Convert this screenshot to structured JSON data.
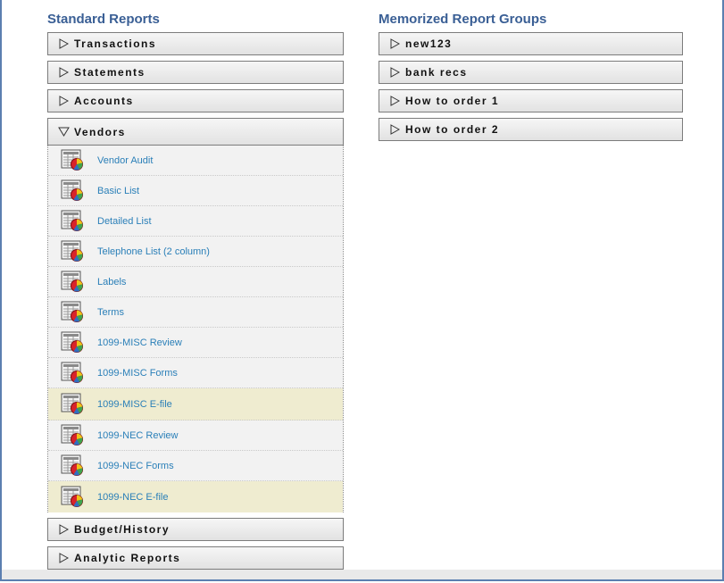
{
  "standard": {
    "title": "Standard Reports",
    "groups_top": [
      {
        "label": "Transactions"
      },
      {
        "label": "Statements"
      },
      {
        "label": "Accounts"
      }
    ],
    "open_group": {
      "label": "Vendors",
      "reports": [
        {
          "label": "Vendor Audit",
          "selected": false
        },
        {
          "label": "Basic List",
          "selected": false
        },
        {
          "label": "Detailed List",
          "selected": false
        },
        {
          "label": "Telephone List (2 column)",
          "selected": false
        },
        {
          "label": "Labels",
          "selected": false
        },
        {
          "label": "Terms",
          "selected": false
        },
        {
          "label": "1099-MISC Review",
          "selected": false
        },
        {
          "label": "1099-MISC Forms",
          "selected": false
        },
        {
          "label": "1099-MISC E-file",
          "selected": true
        },
        {
          "label": "1099-NEC Review",
          "selected": false
        },
        {
          "label": "1099-NEC Forms",
          "selected": false
        },
        {
          "label": "1099-NEC E-file",
          "selected": true
        }
      ]
    },
    "groups_bottom": [
      {
        "label": "Budget/History"
      },
      {
        "label": "Analytic Reports"
      }
    ]
  },
  "memorized": {
    "title": "Memorized Report Groups",
    "groups": [
      {
        "label": "new123"
      },
      {
        "label": "bank recs"
      },
      {
        "label": "How to order 1"
      },
      {
        "label": "How to order 2"
      }
    ]
  },
  "icons": {
    "collapsed": "triangle-right-icon",
    "expanded": "triangle-down-icon",
    "report": "report-icon"
  },
  "colors": {
    "title": "#3a5f95",
    "link": "#2a7fb8",
    "selected_row": "#efecd0",
    "frame": "#5b7fb0"
  }
}
